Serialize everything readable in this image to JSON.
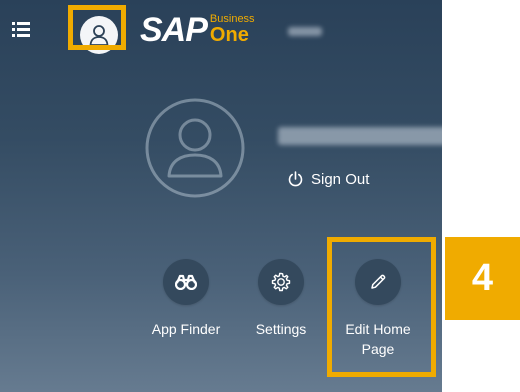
{
  "header": {
    "brand_mark": "SAP",
    "brand_product_top": "Business",
    "brand_product_bottom": "One",
    "company_name": "",
    "menu_icon": "hamburger-menu-icon",
    "avatar_icon": "user-avatar-icon"
  },
  "user_card": {
    "user_name": "",
    "sign_out_label": "Sign Out",
    "sign_out_icon": "power-icon",
    "avatar_icon": "user-avatar-icon"
  },
  "actions": [
    {
      "label": "App Finder",
      "icon": "binoculars-icon"
    },
    {
      "label": "Settings",
      "icon": "gear-icon"
    },
    {
      "label": "Edit Home Page",
      "icon": "pencil-icon"
    }
  ],
  "callout": {
    "step_number": "4"
  },
  "colors": {
    "highlight": "#f0ab00",
    "panel_top": "#2a4159",
    "panel_bottom": "#667b90",
    "button_circle": "#34495d"
  }
}
